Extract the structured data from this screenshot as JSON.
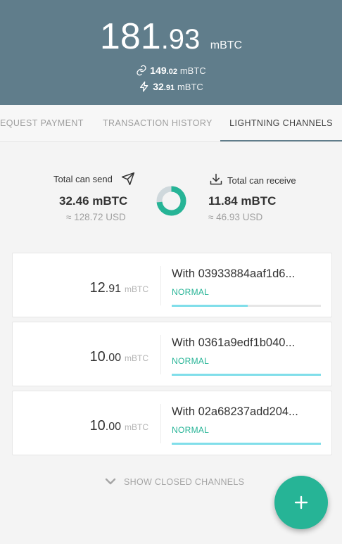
{
  "header": {
    "balance_int": "181",
    "balance_dec": ".93",
    "balance_unit": "mBTC",
    "onchain_int": "149",
    "onchain_dec": ".02",
    "onchain_unit": "mBTC",
    "lightning_int": "32",
    "lightning_dec": ".91",
    "lightning_unit": "mBTC"
  },
  "tabs": [
    {
      "label": "EQUEST PAYMENT",
      "active": false
    },
    {
      "label": "TRANSACTION HISTORY",
      "active": false
    },
    {
      "label": "LIGHTNING CHANNELS",
      "active": true
    }
  ],
  "summary": {
    "send_label": "Total can send",
    "send_value": "32.46 mBTC",
    "send_usd": "≈ 128.72 USD",
    "receive_label": "Total can receive",
    "receive_value": "11.84 mBTC",
    "receive_usd": "≈ 46.93 USD",
    "send_fraction": 0.733
  },
  "channels": [
    {
      "amount_int": "12",
      "amount_dec": ".91",
      "unit": "mBTC",
      "peer": "With 03933884aaf1d6...",
      "state": "NORMAL",
      "fill": 0.51
    },
    {
      "amount_int": "10",
      "amount_dec": ".00",
      "unit": "mBTC",
      "peer": "With 0361a9edf1b040...",
      "state": "NORMAL",
      "fill": 1.0
    },
    {
      "amount_int": "10",
      "amount_dec": ".00",
      "unit": "mBTC",
      "peer": "With 02a68237add204...",
      "state": "NORMAL",
      "fill": 1.0
    }
  ],
  "show_closed_label": "SHOW CLOSED CHANNELS",
  "colors": {
    "header": "#607d8b",
    "accent": "#26b496",
    "bar": "#80deea"
  },
  "icons": {
    "onchain": "link-icon",
    "lightning": "bolt-icon",
    "send": "send-icon",
    "receive": "download-icon",
    "expand": "chevron-down-icon",
    "fab": "plus-icon"
  }
}
